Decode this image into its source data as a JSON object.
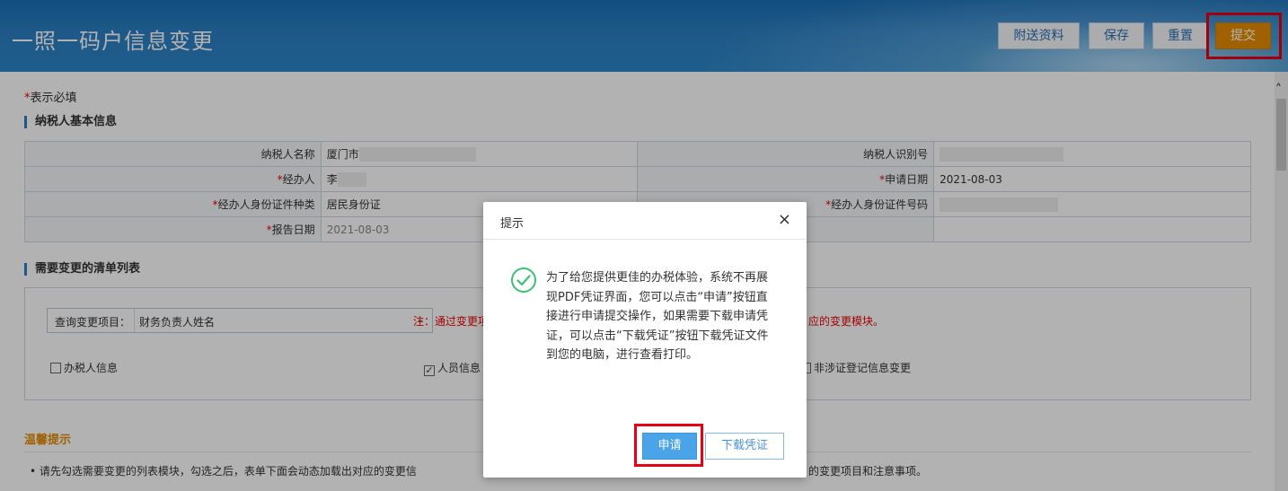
{
  "header": {
    "title": "一照一码户信息变更",
    "buttons": {
      "attach": "附送资料",
      "save": "保存",
      "reset": "重置",
      "submit": "提交"
    }
  },
  "required_note": {
    "star": "*",
    "text": "表示必填"
  },
  "basic_info": {
    "section_title": "纳税人基本信息",
    "rows": [
      {
        "l1": "纳税人名称",
        "v1": "厦门市",
        "l2": "纳税人识别号",
        "v2": ""
      },
      {
        "l1": "经办人",
        "v1": "李",
        "l2": "申请日期",
        "v2": "2021-08-03"
      },
      {
        "l1": "经办人身份证件种类",
        "v1": "居民身份证",
        "l2": "经办人身份证件号码",
        "v2": ""
      },
      {
        "l1": "报告日期",
        "v1": "2021-08-03",
        "l2": "",
        "v2": ""
      }
    ],
    "star": "*"
  },
  "change_list": {
    "section_title": "需要变更的清单列表",
    "query_label": "查询变更项目：",
    "query_value": "财务负责人姓名",
    "note_left": "注：通过变更项",
    "note_right": "应的变更模块。",
    "checkboxes": [
      {
        "label": "办税人信息",
        "checked": false,
        "mark": ""
      },
      {
        "label": "人员信息",
        "checked": true,
        "mark": "✓"
      },
      {
        "label": "非涉证登记信息变更",
        "checked": false,
        "mark": ""
      }
    ]
  },
  "tips": {
    "title": "温馨提示",
    "text_left": "• 请先勾选需要变更的列表模块，勾选之后，表单下面会动态加载出对应的变更信",
    "text_right": "的变更项目和注意事项。"
  },
  "dialog": {
    "title": "提示",
    "close": "×",
    "message": "为了给您提供更佳的办税体验，系统不再展现PDF凭证界面，您可以点击“申请”按钮直接进行申请提交操作，如果需要下载申请凭证，可以点击“下载凭证”按钮下载凭证文件到您的电脑，进行查看打印。",
    "apply": "申请",
    "download": "下载凭证"
  },
  "icons": {
    "success": "check-circle-icon",
    "close": "close-icon",
    "chevron": "chevron-down-icon",
    "scroll_up": "chevron-up-icon"
  },
  "colors": {
    "header_blue": "#2a7fc4",
    "submit_orange": "#e58d00",
    "highlight_red": "#e60012",
    "apply_blue": "#4ba3e8",
    "success_green": "#3fbf75"
  }
}
